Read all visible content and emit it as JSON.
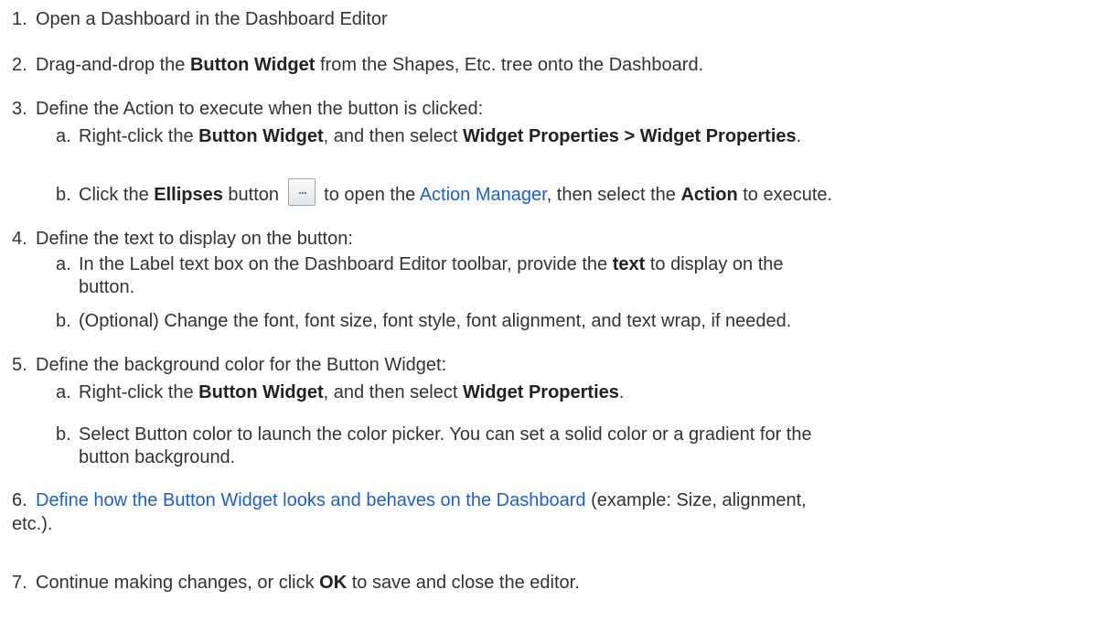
{
  "steps": [
    {
      "num": "1.",
      "text": "Open a Dashboard in the Dashboard Editor"
    },
    {
      "num": "2.",
      "pre": "Drag-and-drop the ",
      "bold": "Button Widget",
      "post": " from the Shapes, Etc. tree onto the Dashboard."
    },
    {
      "num": "3.",
      "text": "Define the Action to execute when the button is clicked:",
      "subs": [
        {
          "letter": "a.",
          "pre": "Right-click the ",
          "bold1": "Button Widget",
          "mid": ", and then select ",
          "bold2": "Widget Properties > Widget Properties",
          "post": "."
        },
        {
          "letter": "b.",
          "pre": "Click the ",
          "bold1": "Ellipses",
          "mid1": " button",
          "mid2": " to open the ",
          "link": "Action Manager",
          "mid3": ", then select the ",
          "bold2": "Action",
          "post": " to execute."
        }
      ]
    },
    {
      "num": "4.",
      "text": "Define the text to display on the button:",
      "subs": [
        {
          "letter": "a.",
          "pre": "In the Label text box on the Dashboard Editor toolbar, provide the ",
          "bold": "text",
          "post": " to display on the",
          "cont": "button."
        },
        {
          "letter": "b.",
          "text": "(Optional) Change the font, font size, font style, font alignment, and text wrap, if needed."
        }
      ]
    },
    {
      "num": "5.",
      "text": "Define the background color for the Button Widget:",
      "subs": [
        {
          "letter": "a.",
          "pre": "Right-click the ",
          "bold1": "Button Widget",
          "mid": ", and then select ",
          "bold2": "Widget Properties",
          "post": "."
        },
        {
          "letter": "b.",
          "text": "Select Button color to launch the color picker. You can set a solid color or a gradient for the",
          "cont": "button background."
        }
      ]
    },
    {
      "num": "6.",
      "link": "Define how the Button Widget looks and behaves on the Dashboard",
      "post": " (example: Size, alignment,",
      "cont": "etc.)."
    },
    {
      "num": "7.",
      "pre": "Continue making changes, or click ",
      "bold": "OK",
      "post": " to save and close the editor."
    }
  ]
}
